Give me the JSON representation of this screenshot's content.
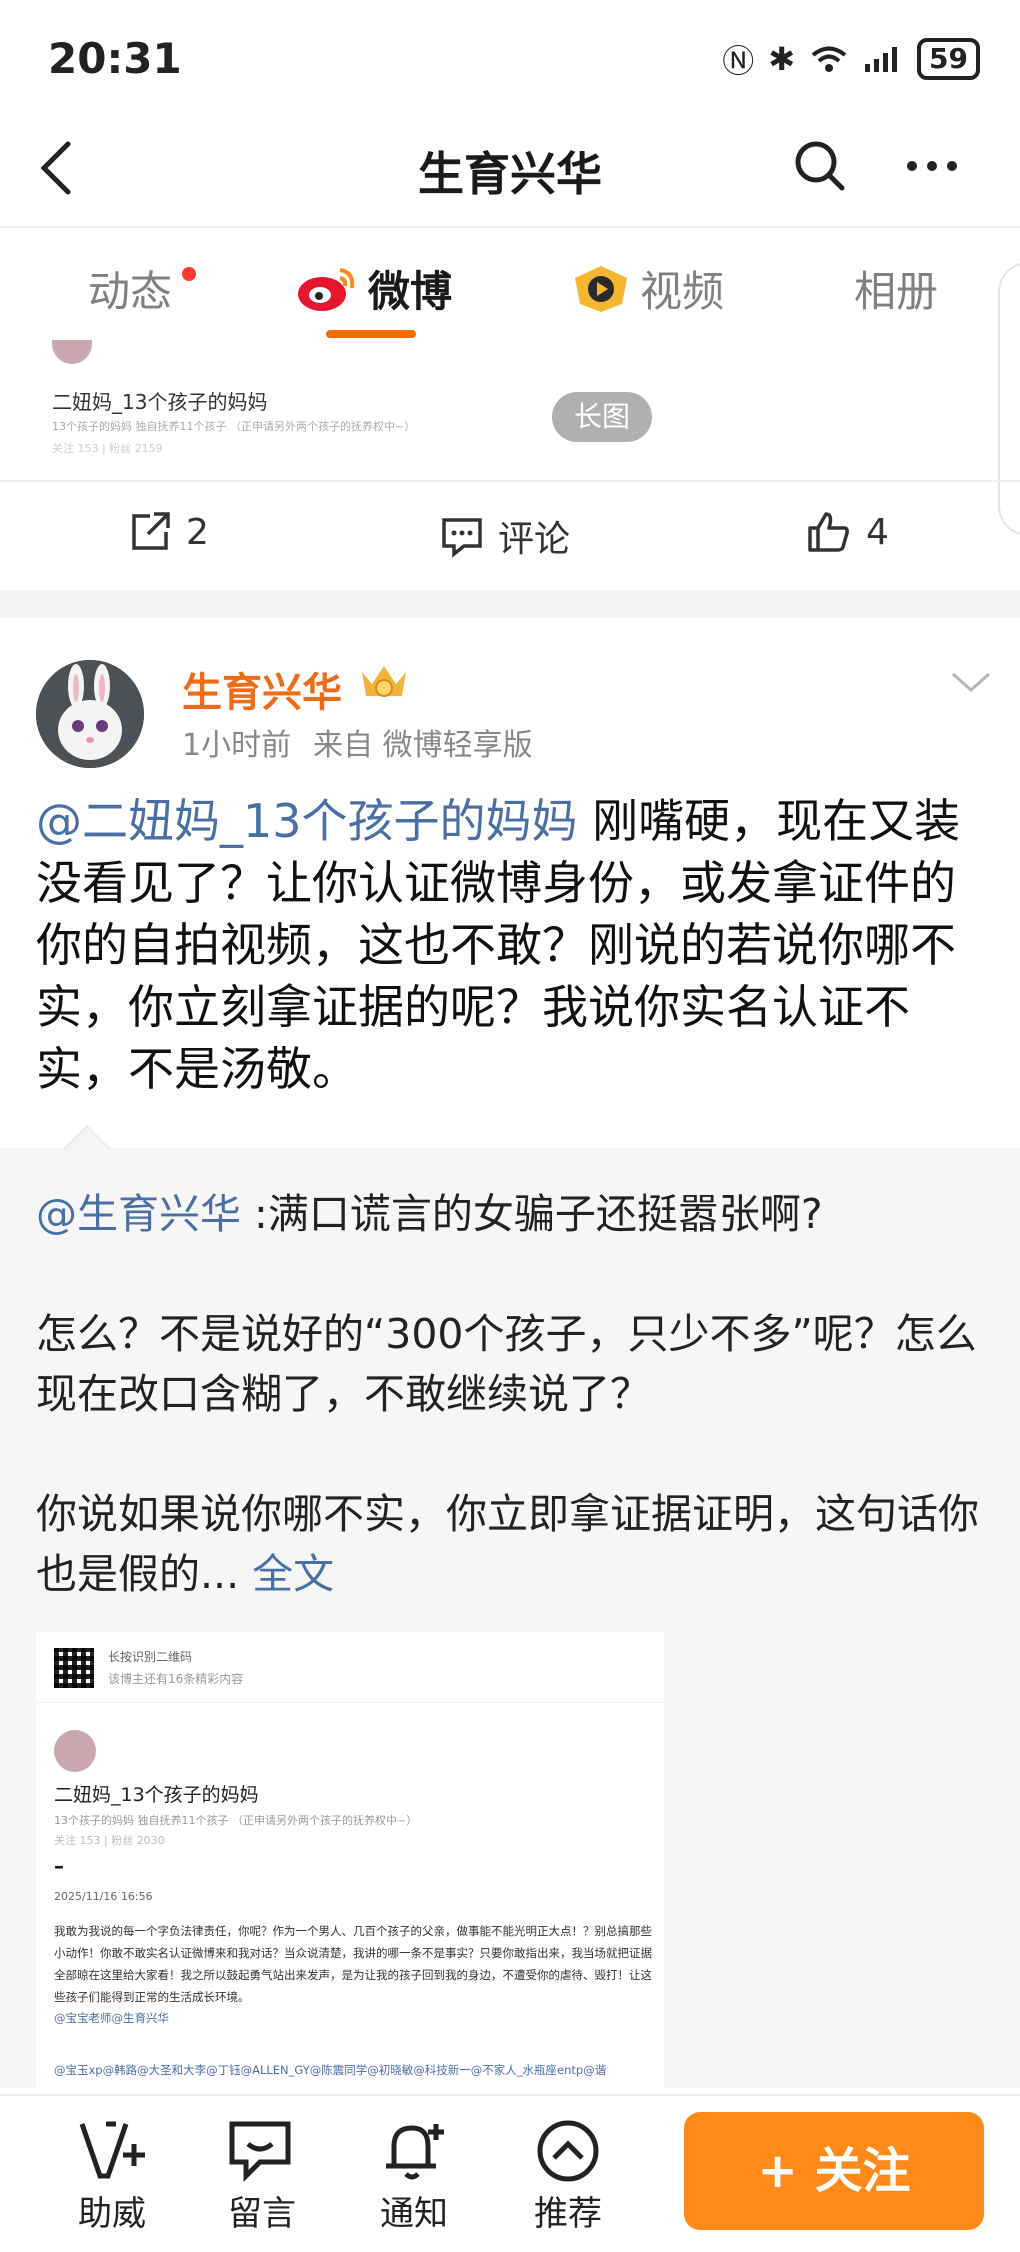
{
  "status_bar": {
    "time": "20:31",
    "battery": "59"
  },
  "nav": {
    "title": "生育兴华"
  },
  "tabs": [
    {
      "label": "动态",
      "has_dot": true
    },
    {
      "label": "微博",
      "active": true
    },
    {
      "label": "视频"
    },
    {
      "label": "相册"
    }
  ],
  "prev_card": {
    "author": "二妞妈_13个孩子的妈妈",
    "subtitle": "13个孩子的妈妈  独自抚养11个孩子 （正申请另外两个孩子的抚养权中~）",
    "stats": "关注 153 | 粉丝 2159",
    "badge": "长图",
    "share_count": "2",
    "comment_label": "评论",
    "like_count": "4"
  },
  "post": {
    "author": "生育兴华",
    "time": "1小时前",
    "source": "来自 微博轻享版",
    "mention": "@二妞妈_13个孩子的妈妈",
    "text": " 刚嘴硬，现在又装没看见了？让你认证微博身份，或发拿证件的你的自拍视频，这也不敢？刚说的若说你哪不实，你立刻拿证据的呢？我说你实名认证不实，不是汤敬。"
  },
  "repost": {
    "mention": "@生育兴华",
    "line1": " :满口谎言的女骗子还挺嚣张啊?",
    "para2": "怎么？不是说好的“300个孩子，只少不多”呢？怎么现在改口含糊了，不敢继续说了？",
    "para3": "你说如果说你哪不实，你立即拿证据证明，这句话你也是假的...",
    "full_text": " 全文",
    "embed": {
      "qr_title": "长按识别二维码",
      "qr_sub": "该博主还有16条精彩内容",
      "name": "二妞妈_13个孩子的妈妈",
      "sub": "13个孩子的妈妈  独自抚养11个孩子 （正申请另外两个孩子的抚养权中~）",
      "stats": "关注 153 | 粉丝 2030",
      "dash": "–",
      "date": "2025/11/16 16:56",
      "body": "我敢为我说的每一个字负法律责任，你呢？作为一个男人、几百个孩子的父亲，做事能不能光明正大点！？别总搞那些小动作！你敢不敢实名认证微博来和我对话？当众说清楚，我讲的哪一条不是事实？只要你敢指出来，我当场就把证据全部晾在这里给大家看！我之所以鼓起勇气站出来发声，是为让我的孩子回到我的身边，不遭受你的虐待、毁打！让这些孩子们能得到正常的生活成长环境。",
      "tags": "@宝宝老师@生育兴华",
      "mentions": "@宝玉xp@韩路@大圣和大李@丁钰@ALLEN_GY@陈震同学@初晓敏@科技新一@不家人_水瓶座entp@谐"
    }
  },
  "bottom_bar": {
    "items": [
      "助威",
      "留言",
      "通知",
      "推荐"
    ],
    "follow": "+ 关注"
  },
  "colors": {
    "accent": "#ff6a00",
    "link": "#4a6fa5",
    "author": "#ee6b18",
    "follow_bg": "#ff8a1a"
  }
}
